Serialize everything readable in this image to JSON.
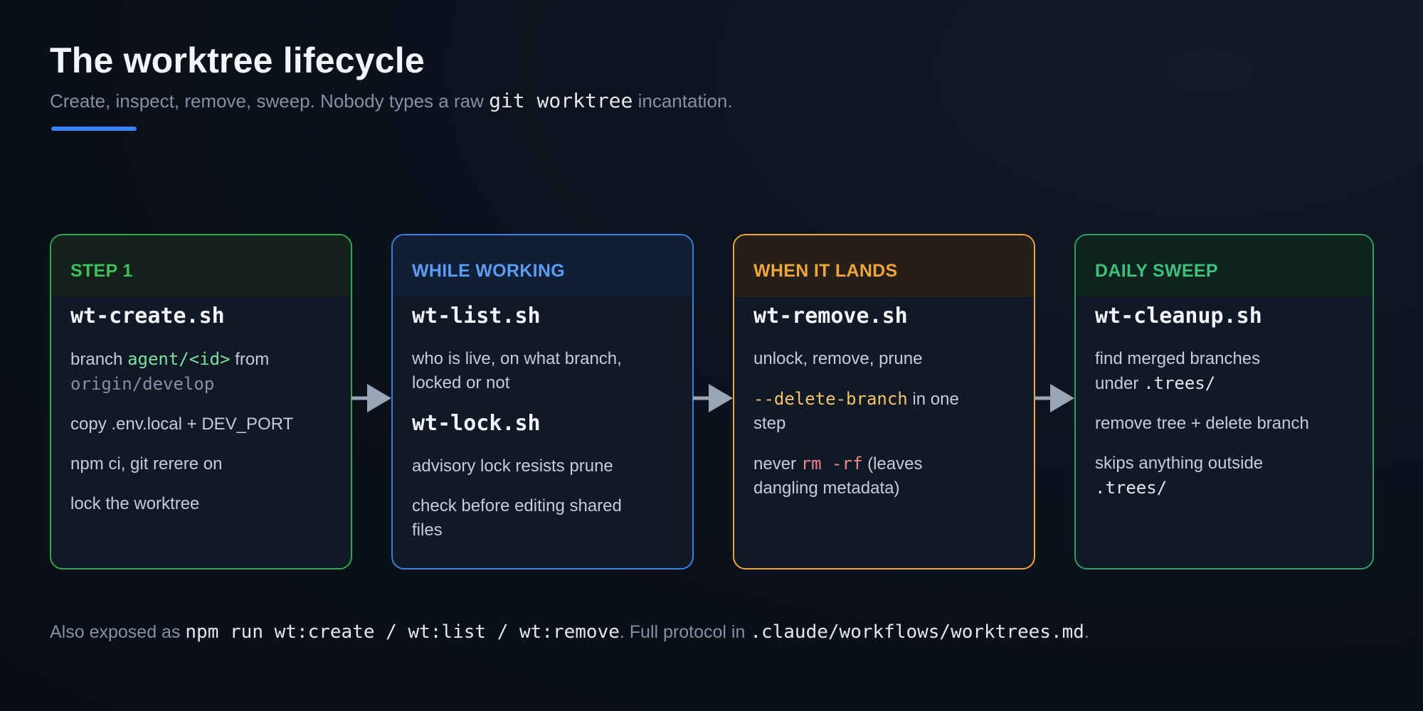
{
  "header": {
    "title": "The worktree lifecycle",
    "subtitle_pre": "Create, inspect, remove, sweep. Nobody types a raw ",
    "subtitle_code": "git worktree",
    "subtitle_post": " incantation."
  },
  "colors": {
    "accent": "#3b82f6",
    "green": "#3fbf5d",
    "blue": "#5c9cf2",
    "orange": "#f0a53a",
    "teal": "#3fbf7d",
    "code_green": "#7ee0a0",
    "code_yellow": "#f2c46d",
    "code_red": "#f08a8a"
  },
  "cards": [
    {
      "tag": "STEP 1",
      "script": "wt-create.sh",
      "l1_pre": "branch ",
      "l1_code": "agent/<id>",
      "l1_post": " from",
      "l1_code2": "origin/develop",
      "l2": "copy .env.local + DEV_PORT",
      "l3": "npm ci, git rerere on",
      "l4": "lock the worktree"
    },
    {
      "tag": "WHILE WORKING",
      "script": "wt-list.sh",
      "l1": "who is live, on what branch, locked or not",
      "script2": "wt-lock.sh",
      "l2": "advisory lock resists prune",
      "l3": "check before editing shared files"
    },
    {
      "tag": "WHEN IT LANDS",
      "script": "wt-remove.sh",
      "l1": "unlock, remove, prune",
      "l2_code": "--delete-branch",
      "l2_post": " in one step",
      "l3_pre": "never ",
      "l3_code": "rm -rf",
      "l3_post": " (leaves dangling metadata)"
    },
    {
      "tag": "DAILY SWEEP",
      "script": "wt-cleanup.sh",
      "l1_pre": "find merged branches under ",
      "l1_code": ".trees/",
      "l2": "remove tree + delete branch",
      "l3_pre": "skips anything outside ",
      "l3_code": ".trees/"
    }
  ],
  "footer": {
    "pre": "Also exposed as ",
    "code1": "npm run wt:create / wt:list / wt:remove",
    "mid": ". Full protocol in ",
    "code2": ".claude/workflows/worktrees.md",
    "post": "."
  }
}
